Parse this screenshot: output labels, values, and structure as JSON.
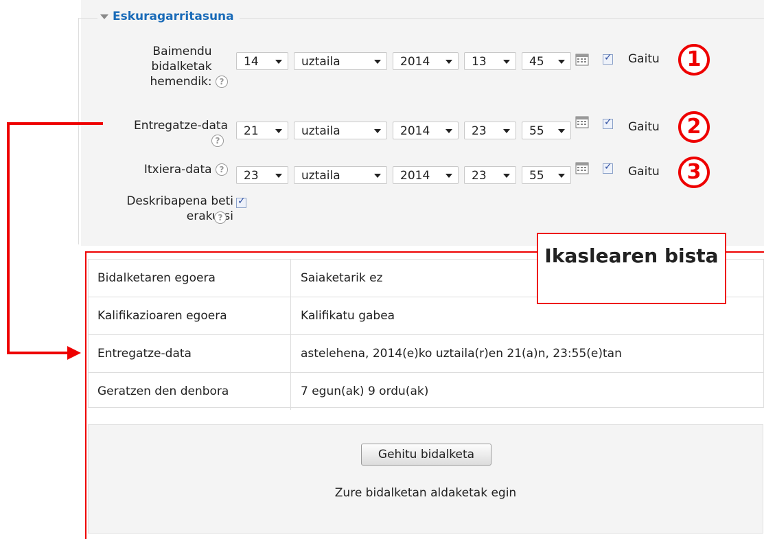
{
  "section": {
    "title": "Eskuragarritasuna"
  },
  "rows": [
    {
      "label": "Baimendu bidalketak hemendik:",
      "day": "14",
      "month": "uztaila",
      "year": "2014",
      "hour": "13",
      "minute": "45",
      "enable_label": "Gaitu",
      "badge": "1",
      "enabled": true
    },
    {
      "label": "Entregatze-data",
      "day": "21",
      "month": "uztaila",
      "year": "2014",
      "hour": "23",
      "minute": "55",
      "enable_label": "Gaitu",
      "badge": "2",
      "enabled": true
    },
    {
      "label": "Itxiera-data",
      "day": "23",
      "month": "uztaila",
      "year": "2014",
      "hour": "23",
      "minute": "55",
      "enable_label": "Gaitu",
      "badge": "3",
      "enabled": true
    }
  ],
  "always_show": {
    "label": "Deskribapena beti erakutsi",
    "checked": true
  },
  "student_view": {
    "callout": "Ikaslearen bista",
    "table": [
      {
        "key": "Bidalketaren egoera",
        "value": "Saiaketarik ez"
      },
      {
        "key": "Kalifikazioaren egoera",
        "value": "Kalifikatu gabea"
      },
      {
        "key": "Entregatze-data",
        "value": "astelehena, 2014(e)ko uztaila(r)en 21(a)n, 23:55(e)tan"
      },
      {
        "key": "Geratzen den denbora",
        "value": "7 egun(ak) 9 ordu(ak)"
      }
    ],
    "button_label": "Gehitu bidalketa",
    "note": "Zure bidalketan aldaketak egin"
  },
  "colors": {
    "accent": "#1a6bb8",
    "annotation": "#e00000",
    "panel_bg": "#f4f4f4"
  }
}
